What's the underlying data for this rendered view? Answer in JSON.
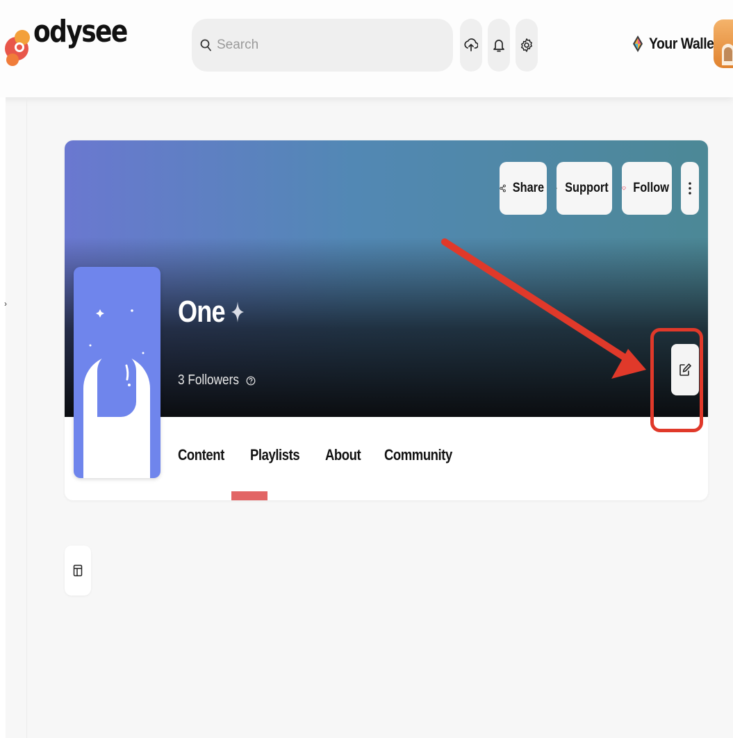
{
  "header": {
    "logo_text": "odysee",
    "search": {
      "placeholder": "Search"
    },
    "wallet_label": "Your Wallet",
    "icons": [
      "upload-icon",
      "bell-icon",
      "gear-icon"
    ]
  },
  "channel": {
    "name": "One",
    "followers_text": "3 Followers",
    "actions": {
      "share_label": "Share",
      "support_label": "Support",
      "follow_label": "Follow"
    },
    "tabs": [
      {
        "label": "Content"
      },
      {
        "label": "Playlists"
      },
      {
        "label": "About"
      },
      {
        "label": "Community"
      }
    ],
    "active_tab": "Playlists"
  },
  "colors": {
    "accent": "#e26565",
    "annotation": "#e0392a",
    "thumb_bg": "#6f85ec"
  }
}
